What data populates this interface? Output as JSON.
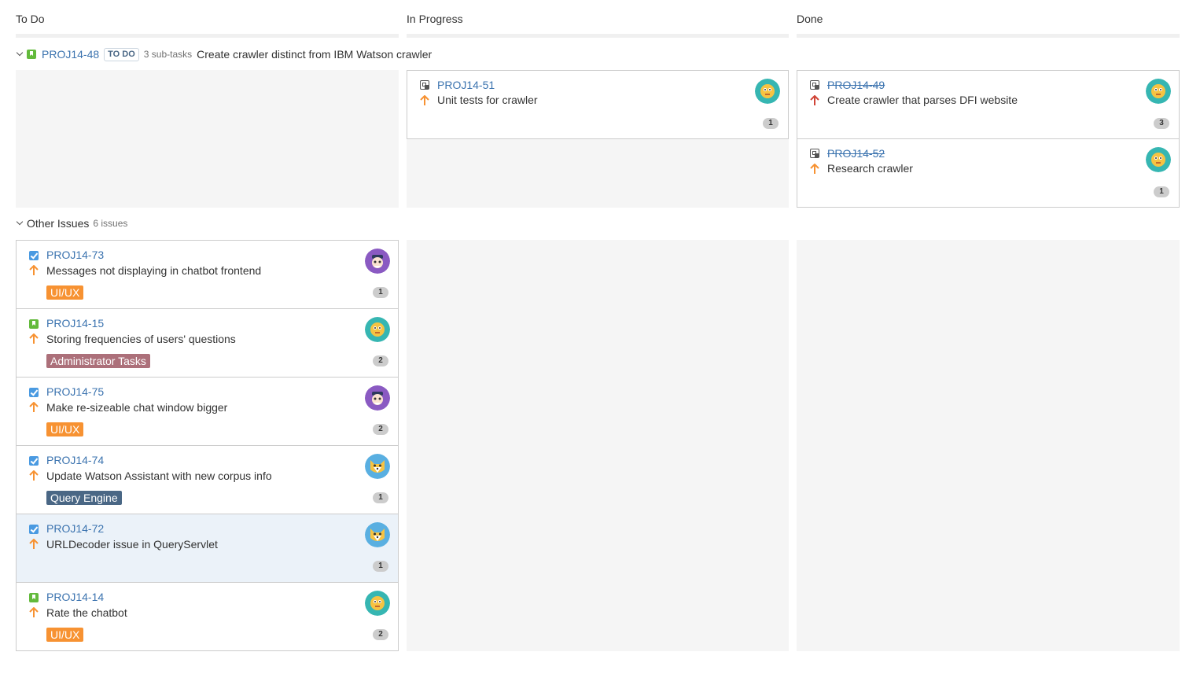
{
  "columns": [
    {
      "title": "To Do"
    },
    {
      "title": "In Progress"
    },
    {
      "title": "Done"
    }
  ],
  "parent_swimlane": {
    "key": "PROJ14-48",
    "status": "TO DO",
    "subtasks": "3 sub-tasks",
    "summary": "Create crawler distinct from IBM Watson crawler"
  },
  "parent_cards": {
    "in_progress": [
      {
        "key": "PROJ14-51",
        "summary": "Unit tests for crawler",
        "estimate": "1",
        "priority": "major",
        "avatar": "teal-face"
      }
    ],
    "done": [
      {
        "key": "PROJ14-49",
        "summary": "Create crawler that parses DFI website",
        "estimate": "3",
        "priority": "critical",
        "avatar": "teal-face"
      },
      {
        "key": "PROJ14-52",
        "summary": "Research crawler",
        "estimate": "1",
        "priority": "major",
        "avatar": "teal-face"
      }
    ]
  },
  "other_swimlane": {
    "title": "Other Issues",
    "count": "6 issues"
  },
  "todo_cards": [
    {
      "key": "PROJ14-73",
      "summary": "Messages not displaying in chatbot frontend",
      "epic": "UI/UX",
      "epic_color": "#f79232",
      "estimate": "1",
      "type": "task",
      "avatar": "purple-person"
    },
    {
      "key": "PROJ14-15",
      "summary": "Storing frequencies of users' questions",
      "epic": "Administrator Tasks",
      "epic_color": "#ac707a",
      "estimate": "2",
      "type": "story",
      "avatar": "teal-face"
    },
    {
      "key": "PROJ14-75",
      "summary": "Make re-sizeable chat window bigger",
      "epic": "UI/UX",
      "epic_color": "#f79232",
      "estimate": "2",
      "type": "task",
      "avatar": "purple-person"
    },
    {
      "key": "PROJ14-74",
      "summary": "Update Watson Assistant with new corpus info",
      "epic": "Query Engine",
      "epic_color": "#4a6785",
      "estimate": "1",
      "type": "task",
      "avatar": "blue-fox"
    },
    {
      "key": "PROJ14-72",
      "summary": "URLDecoder issue in QueryServlet",
      "epic": "",
      "epic_color": "",
      "estimate": "1",
      "type": "task",
      "avatar": "blue-fox",
      "selected": true
    },
    {
      "key": "PROJ14-14",
      "summary": "Rate the chatbot",
      "epic": "UI/UX",
      "epic_color": "#f79232",
      "estimate": "2",
      "type": "story",
      "avatar": "teal-face"
    }
  ],
  "colors": {
    "link": "#3b73af",
    "priority_major": "#f79232",
    "priority_critical": "#d04437",
    "column_bg": "#f5f5f5"
  }
}
